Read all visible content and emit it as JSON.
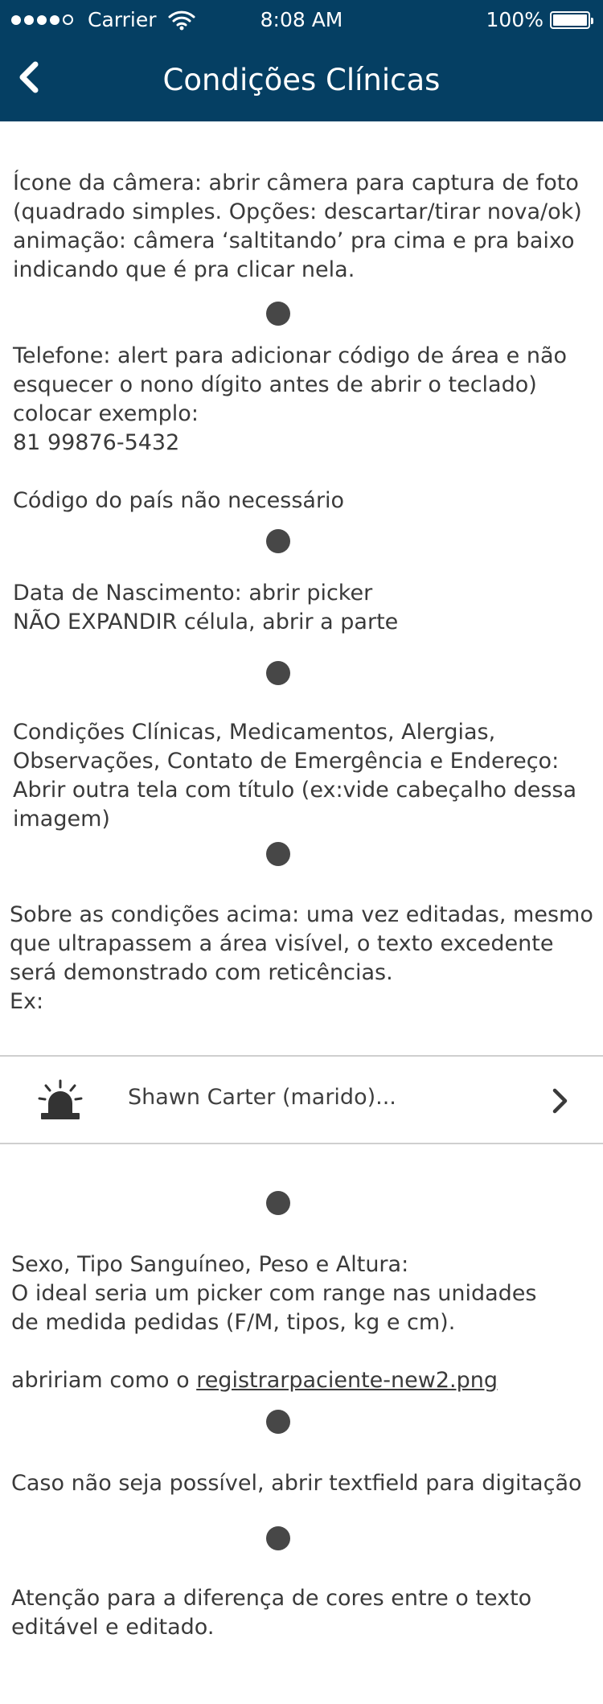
{
  "status_bar": {
    "carrier": "Carrier",
    "time": "8:08 AM",
    "battery": "100%"
  },
  "nav": {
    "title": "Condições Clínicas",
    "back_icon": "chevron-left-icon"
  },
  "notes": {
    "camera": "Ícone da câmera: abrir câmera para captura de foto\n(quadrado simples. Opções: descartar/tirar nova/ok)\nanimação: câmera ‘saltitando’ pra cima e pra baixo\nindicando que é pra clicar nela.",
    "phone": "Telefone: alert para adicionar código de área e não\nesquecer o nono dígito antes de abrir o teclado)\ncolocar exemplo:\n81 99876-5432\n\nCódigo do país não necessário",
    "birth": "Data de Nascimento: abrir picker\nNÃO EXPANDIR célula, abrir a parte",
    "conditions": "Condições Clínicas, Medicamentos, Alergias,\nObservações, Contato de Emergência e Endereço:\nAbrir outra tela com título (ex:vide cabeçalho dessa\nimagem)",
    "edited": "Sobre as condições acima: uma vez editadas, mesmo\nque ultrapassem a área visível, o texto excedente\nserá demonstrado com reticências.\nEx:",
    "sex": "Sexo, Tipo Sanguíneo, Peso e Altura:\nO ideal seria um picker com range nas unidades\nde medida pedidas (F/M, tipos, kg e cm).",
    "open_as_prefix": "abririam como o ",
    "open_as_link": "registrarpaciente-new2.png",
    "fallback": "Caso não seja possível, abrir textfield para digitação",
    "colors": "Atenção para a diferença de cores entre o texto\neditável e editado."
  },
  "contact_example": {
    "text": "Shawn Carter (marido)...",
    "icon": "alarm-siren-icon",
    "chevron_icon": "chevron-right-icon"
  },
  "colors": {
    "header_bg": "#053f63",
    "text": "#3a3a3a",
    "bullet": "#474747",
    "divider": "#cfcfcf"
  }
}
